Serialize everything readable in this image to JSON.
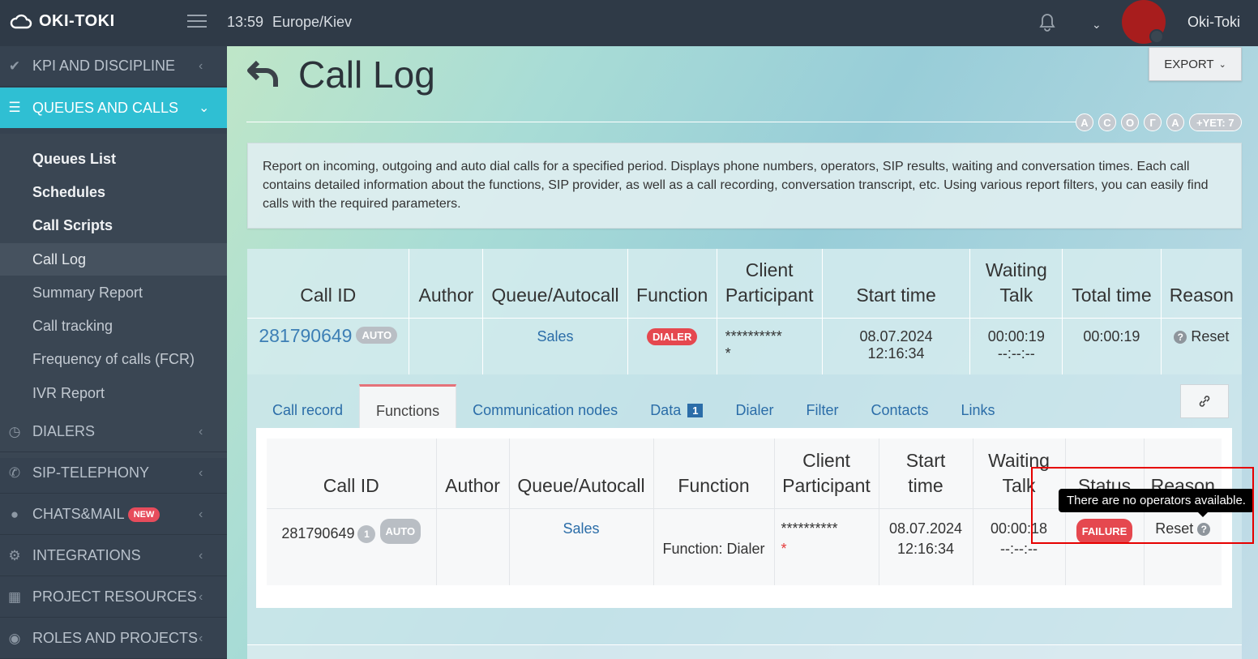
{
  "app": {
    "name": "OKI-TOKI",
    "time": "13:59",
    "timezone": "Europe/Kiev",
    "user": "Oki-Toki"
  },
  "sidebar": {
    "sections": [
      {
        "label": "KPI AND DISCIPLINE",
        "icon": "check-icon"
      },
      {
        "label": "QUEUES AND CALLS",
        "icon": "list-icon"
      },
      {
        "label": "DIALERS",
        "icon": "clock-icon"
      },
      {
        "label": "SIP-TELEPHONY",
        "icon": "phone-icon"
      },
      {
        "label": "CHATS&MAIL",
        "icon": "chat-icon",
        "badge": "NEW"
      },
      {
        "label": "INTEGRATIONS",
        "icon": "gears-icon"
      },
      {
        "label": "PROJECT RESOURCES",
        "icon": "grid-icon"
      },
      {
        "label": "ROLES AND PROJECTS",
        "icon": "toggle-icon"
      }
    ],
    "sub_items": [
      "Queues List",
      "Schedules",
      "Call Scripts",
      "Call Log",
      "Summary Report",
      "Call tracking",
      "Frequency of calls (FCR)",
      "IVR Report"
    ]
  },
  "page": {
    "title": "Call Log",
    "export_label": "EXPORT",
    "letters": [
      "А",
      "С",
      "О",
      "Г",
      "А"
    ],
    "letters_more": "+YET: 7",
    "description": "Report on incoming, outgoing and auto dial calls for a specified period. Displays phone numbers, operators, SIP results, waiting and conversation times. Each call contains detailed information about the functions, SIP provider, as well as a call recording, conversation transcript, etc. Using various report filters, you can easily find calls with the required parameters."
  },
  "main_table": {
    "headers": {
      "call_id": "Call ID",
      "author": "Author",
      "queue": "Queue/Autocall",
      "function": "Function",
      "client": "Client",
      "participant": "Participant",
      "start_time": "Start time",
      "waiting": "Waiting",
      "talk": "Talk",
      "total_time": "Total time",
      "reason": "Reason"
    },
    "row": {
      "call_id": "281790649",
      "auto_badge": "AUTO",
      "author": "",
      "queue": "Sales",
      "function_badge": "DIALER",
      "client": "**********",
      "client_tail": "*",
      "start_time": "08.07.2024 12:16:34",
      "waiting": "00:00:19",
      "talk": "--:--:--",
      "total_time": "00:00:19",
      "reason": "Reset"
    }
  },
  "detail": {
    "tabs": [
      "Call record",
      "Functions",
      "Communication nodes",
      "Data",
      "Dialer",
      "Filter",
      "Contacts",
      "Links"
    ],
    "data_badge": "1",
    "headers": {
      "call_id": "Call ID",
      "author": "Author",
      "queue": "Queue/Autocall",
      "function": "Function",
      "client": "Client",
      "participant": "Participant",
      "start": "Start",
      "time": "time",
      "waiting": "Waiting",
      "talk": "Talk",
      "status": "Status",
      "reason": "Reason"
    },
    "row": {
      "call_id": "281790649",
      "num_badge": "1",
      "auto_badge": "AUTO",
      "author": "",
      "queue": "Sales",
      "function": "Function: Dialer",
      "client": "**********",
      "client_tail": "*",
      "start_date": "08.07.2024",
      "start_time": "12:16:34",
      "waiting": "00:00:18",
      "talk": "--:--:--",
      "status": "FAILURE",
      "reason": "Reset"
    }
  },
  "tooltip": "There are no operators available."
}
